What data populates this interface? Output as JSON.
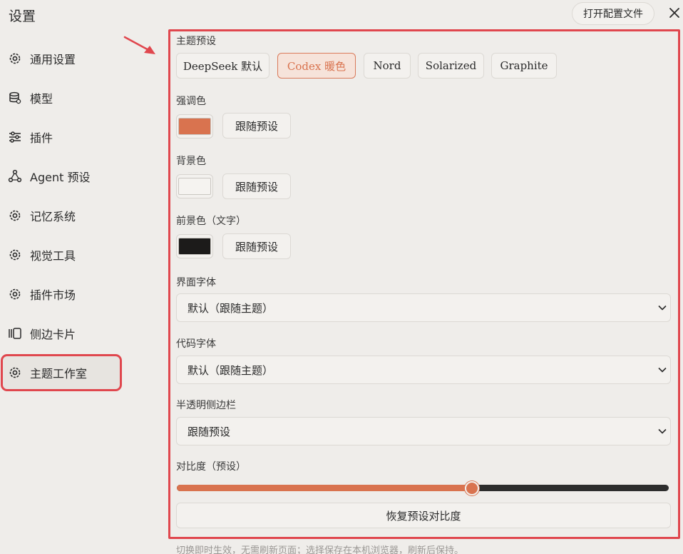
{
  "header": {
    "title": "设置",
    "open_config_label": "打开配置文件",
    "close_icon": "close-icon"
  },
  "sidebar": {
    "items": [
      {
        "label": "通用设置",
        "icon": "gear-icon"
      },
      {
        "label": "模型",
        "icon": "database-icon"
      },
      {
        "label": "插件",
        "icon": "sliders-icon"
      },
      {
        "label": "Agent 预设",
        "icon": "nodes-icon"
      },
      {
        "label": "记忆系统",
        "icon": "gear-icon"
      },
      {
        "label": "视觉工具",
        "icon": "gear-icon"
      },
      {
        "label": "插件市场",
        "icon": "gear-icon"
      },
      {
        "label": "侧边卡片",
        "icon": "cards-icon"
      },
      {
        "label": "主题工作室",
        "icon": "gear-icon",
        "active": true
      }
    ]
  },
  "theme": {
    "preset_label": "主题预设",
    "presets": [
      {
        "label": "DeepSeek 默认"
      },
      {
        "label": "Codex 暖色",
        "selected": true
      },
      {
        "label": "Nord"
      },
      {
        "label": "Solarized"
      },
      {
        "label": "Graphite"
      }
    ],
    "accent_label": "强调色",
    "accent_color": "#d9734f",
    "background_label": "背景色",
    "background_color": "#f5f3f0",
    "foreground_label": "前景色（文字）",
    "foreground_color": "#1c1b1a",
    "follow_preset_label": "跟随预设",
    "ui_font_label": "界面字体",
    "ui_font_value": "默认（跟随主题）",
    "code_font_label": "代码字体",
    "code_font_value": "默认（跟随主题）",
    "sidebar_translucent_label": "半透明侧边栏",
    "sidebar_translucent_value": "跟随预设",
    "contrast_label": "对比度（预设）",
    "contrast_value": 0.6,
    "reset_contrast_label": "恢复预设对比度",
    "footnote": "切换即时生效，无需刷新页面；选择保存在本机浏览器，刷新后保持。"
  },
  "colors": {
    "annotation": "#e0474e",
    "accent": "#d9734f"
  }
}
